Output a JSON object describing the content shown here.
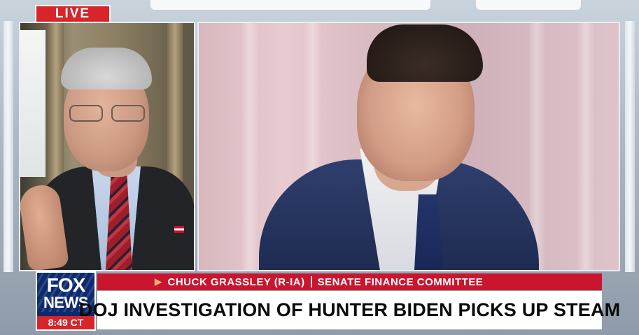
{
  "live_badge": {
    "label": "LIVE"
  },
  "network": {
    "logo_line1": "FOX",
    "logo_line2": "NEWS",
    "clock": "8:49 CT"
  },
  "lower_third": {
    "speaker_name": "CHUCK GRASSLEY (R-IA)",
    "speaker_role": "SENATE FINANCE COMMITTEE",
    "headline": "DOJ INVESTIGATION OF HUNTER BIDEN PICKS UP STEAM"
  },
  "colors": {
    "live_red": "#d8252a",
    "name_bar_red": "#c9152e",
    "logo_blue": "#0f2a6b",
    "headline_bg": "#ffffff"
  }
}
